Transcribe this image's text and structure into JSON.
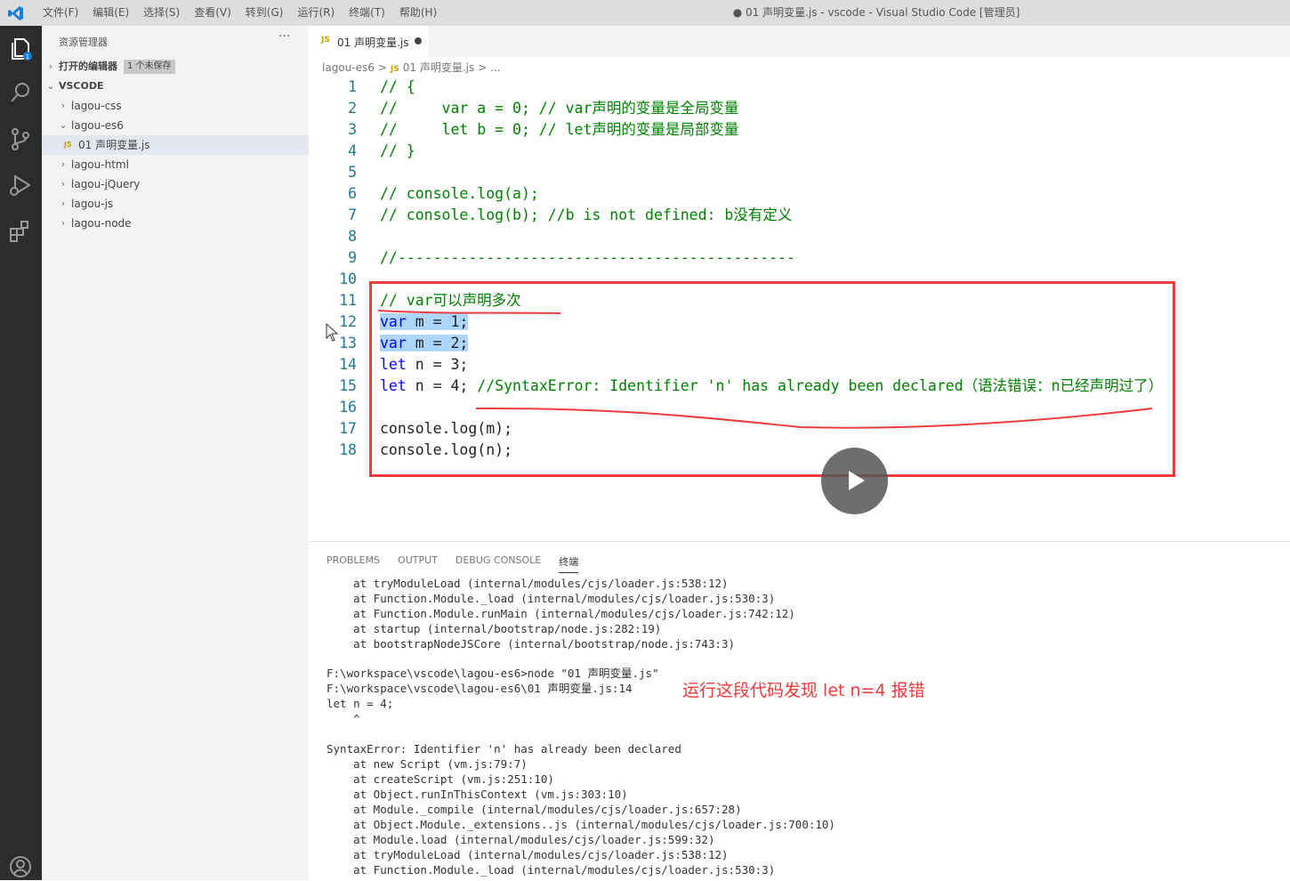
{
  "titlebar": {
    "menu": [
      "文件(F)",
      "编辑(E)",
      "选择(S)",
      "查看(V)",
      "转到(G)",
      "运行(R)",
      "终端(T)",
      "帮助(H)"
    ],
    "window_title": "● 01 声明变量.js - vscode - Visual Studio Code [管理员]"
  },
  "activitybar": {
    "icons": [
      "explorer-icon",
      "search-icon",
      "source-control-icon",
      "run-debug-icon",
      "extensions-icon",
      "account-icon"
    ],
    "badge": "1"
  },
  "sidebar": {
    "title": "资源管理器",
    "more": "···",
    "open_editors_label": "打开的编辑器",
    "open_editors_badge": "1 个未保存",
    "root": "VSCODE",
    "items": [
      {
        "label": "lagou-css",
        "type": "folder",
        "expanded": false
      },
      {
        "label": "lagou-es6",
        "type": "folder",
        "expanded": true
      },
      {
        "label": "01 声明变量.js",
        "type": "file",
        "file_icon": "JS",
        "selected": true
      },
      {
        "label": "lagou-html",
        "type": "folder",
        "expanded": false
      },
      {
        "label": "lagou-jQuery",
        "type": "folder",
        "expanded": false
      },
      {
        "label": "lagou-js",
        "type": "folder",
        "expanded": false
      },
      {
        "label": "lagou-node",
        "type": "folder",
        "expanded": false
      }
    ]
  },
  "editor": {
    "tab": {
      "icon": "JS",
      "label": "01 声明变量.js",
      "modified": true
    },
    "breadcrumb": [
      "lagou-es6",
      ">",
      "JS",
      "01 声明变量.js",
      "> ..."
    ],
    "lines": [
      {
        "n": "1",
        "parts": [
          [
            "cm",
            "// {"
          ]
        ]
      },
      {
        "n": "2",
        "parts": [
          [
            "cm",
            "//     var a = 0; // var声明的变量是全局变量"
          ]
        ]
      },
      {
        "n": "3",
        "parts": [
          [
            "cm",
            "//     let b = 0; // let声明的变量是局部变量"
          ]
        ]
      },
      {
        "n": "4",
        "parts": [
          [
            "cm",
            "// }"
          ]
        ]
      },
      {
        "n": "5",
        "parts": []
      },
      {
        "n": "6",
        "parts": [
          [
            "cm",
            "// console.log(a);"
          ]
        ]
      },
      {
        "n": "7",
        "parts": [
          [
            "cm",
            "// console.log(b); //b is not defined: b没有定义"
          ]
        ]
      },
      {
        "n": "8",
        "parts": []
      },
      {
        "n": "9",
        "parts": [
          [
            "cm",
            "//---------------------------------------------"
          ]
        ]
      },
      {
        "n": "10",
        "parts": []
      },
      {
        "n": "11",
        "parts": [
          [
            "cm",
            "// var可以声明多次"
          ]
        ]
      },
      {
        "n": "12",
        "parts": [
          [
            "kw sel",
            "var"
          ],
          [
            "tx sel",
            " m = 1;"
          ]
        ]
      },
      {
        "n": "13",
        "parts": [
          [
            "kw sel",
            "var"
          ],
          [
            "tx sel",
            " m = 2;"
          ]
        ]
      },
      {
        "n": "14",
        "parts": [
          [
            "kw",
            "let"
          ],
          [
            "tx",
            " n = 3;"
          ]
        ]
      },
      {
        "n": "15",
        "parts": [
          [
            "kw",
            "let"
          ],
          [
            "tx",
            " n = 4; "
          ],
          [
            "cm",
            "//SyntaxError: Identifier 'n' has already been declared（语法错误：n已经声明过了）"
          ]
        ]
      },
      {
        "n": "16",
        "parts": []
      },
      {
        "n": "17",
        "parts": [
          [
            "tx",
            "console.log(m);"
          ]
        ]
      },
      {
        "n": "18",
        "parts": [
          [
            "tx",
            "console.log(n);"
          ]
        ]
      }
    ]
  },
  "panel": {
    "tabs": [
      "PROBLEMS",
      "OUTPUT",
      "DEBUG CONSOLE",
      "终端"
    ],
    "active_tab": "终端",
    "terminal_top": [
      "    at tryModuleLoad (internal/modules/cjs/loader.js:538:12)",
      "    at Function.Module._load (internal/modules/cjs/loader.js:530:3)",
      "    at Function.Module.runMain (internal/modules/cjs/loader.js:742:12)",
      "    at startup (internal/bootstrap/node.js:282:19)",
      "    at bootstrapNodeJSCore (internal/bootstrap/node.js:743:3)"
    ],
    "terminal_mid": [
      "F:\\workspace\\vscode\\lagou-es6>node \"01 声明变量.js\"",
      "F:\\workspace\\vscode\\lagou-es6\\01 声明变量.js:14",
      "let n = 4;",
      "    ^"
    ],
    "terminal_bottom": [
      "SyntaxError: Identifier 'n' has already been declared",
      "    at new Script (vm.js:79:7)",
      "    at createScript (vm.js:251:10)",
      "    at Object.runInThisContext (vm.js:303:10)",
      "    at Module._compile (internal/modules/cjs/loader.js:657:28)",
      "    at Object.Module._extensions..js (internal/modules/cjs/loader.js:700:10)",
      "    at Module.load (internal/modules/cjs/loader.js:599:32)",
      "    at tryModuleLoad (internal/modules/cjs/loader.js:538:12)",
      "    at Function.Module._load (internal/modules/cjs/loader.js:530:3)"
    ]
  },
  "annotation": "运行这段代码发现 let n=4 报错",
  "colors": {
    "highlight_box": "#ee3b3b",
    "annotation": "#ee3b3b",
    "keyword": "#0000ff",
    "comment": "#008000"
  }
}
